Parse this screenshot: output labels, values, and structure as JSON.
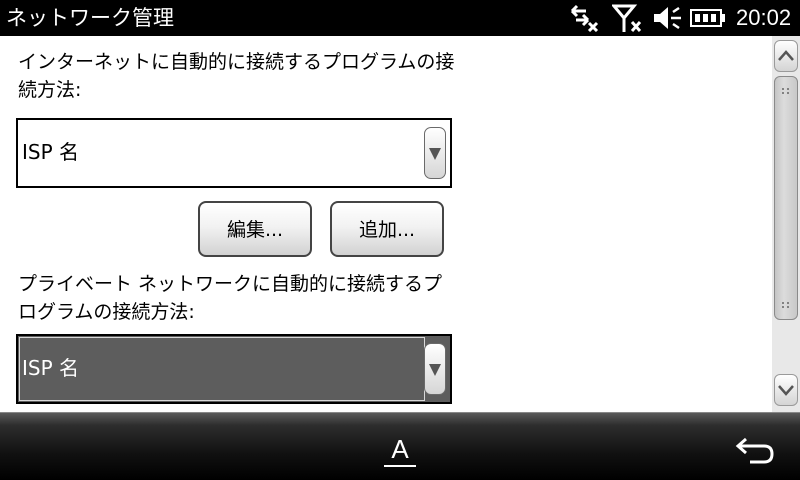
{
  "titlebar": {
    "title": "ネットワーク管理",
    "clock": "20:02",
    "icons": [
      "data-sync-icon",
      "no-signal-icon",
      "speaker-muted-icon",
      "battery-icon"
    ]
  },
  "content": {
    "internet_label": "インターネットに自動的に接続するプログラムの接続方法:",
    "internet_dropdown_value": "ISP 名",
    "edit_button": "編集...",
    "add_button": "追加...",
    "private_label": "プライベート ネットワークに自動的に接続するプログラムの接続方法:",
    "private_dropdown_value": "ISP 名"
  },
  "bottombar": {
    "input_method": "A",
    "back_icon": "back-arrow-icon"
  },
  "colors": {
    "titlebar_bg": "#000000",
    "selected_dropdown_bg": "#5d5d5d"
  }
}
